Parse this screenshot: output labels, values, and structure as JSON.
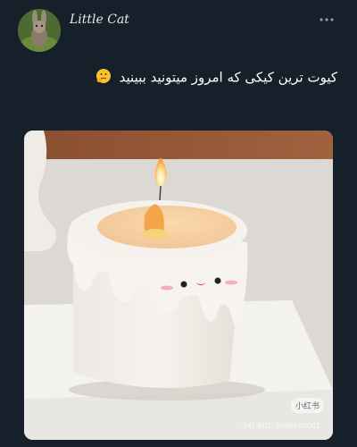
{
  "post": {
    "username": "Little Cat",
    "text": "کیوت ترین کیکی که امروز میتونید ببینید",
    "more_icon": "more-horizontal-icon",
    "emoji_icon": "thinking-face-emoji-icon"
  },
  "media": {
    "watermark_tag": "小红书",
    "watermark_text": "小红书ID: 9666600001"
  },
  "colors": {
    "background": "#15202b",
    "text": "#e7e9ea"
  }
}
